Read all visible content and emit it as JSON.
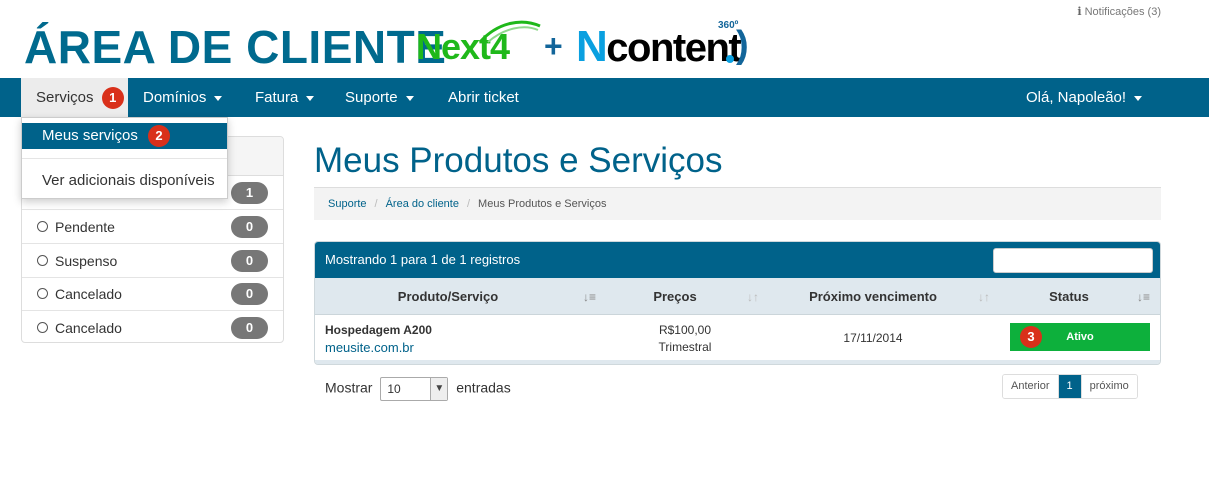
{
  "header": {
    "notifications": "Notificações (3)",
    "brand_title": "ÁREA DE CLIENTE",
    "logo_next4": "Next4",
    "logo_plus": "+",
    "logo_ncontent_n": "N",
    "logo_ncontent_rest": "content",
    "logo_360": "360º",
    "logo_paren": ")"
  },
  "nav": {
    "servicos": "Serviços",
    "servicos_step": "1",
    "dominios": "Domínios",
    "fatura": "Fatura",
    "suporte": "Suporte",
    "abrir_ticket": "Abrir ticket",
    "user": "Olá, Napoleão!"
  },
  "dropdown": {
    "meus_servicos": "Meus serviços",
    "meus_servicos_step": "2",
    "ver_adicionais": "Ver adicionais disponíveis"
  },
  "sidebar": {
    "items": [
      {
        "label": "",
        "count": "1"
      },
      {
        "label": "Pendente",
        "count": "0"
      },
      {
        "label": "Suspenso",
        "count": "0"
      },
      {
        "label": "Cancelado",
        "count": "0"
      },
      {
        "label": "Cancelado",
        "count": "0"
      }
    ]
  },
  "main": {
    "title": "Meus Produtos e Serviços",
    "breadcrumb": [
      "Suporte",
      "Área do cliente",
      "Meus Produtos e Serviços"
    ]
  },
  "table": {
    "showing": "Mostrando 1 para 1 de 1 registros",
    "columns": [
      "Produto/Serviço",
      "Preços",
      "Próximo vencimento",
      "Status"
    ],
    "rows": [
      {
        "product": "Hospedagem A200",
        "domain": "meusite.com.br",
        "price": "R$100,00",
        "cycle": "Trimestral",
        "due": "17/11/2014",
        "status": "Ativo",
        "status_step": "3"
      }
    ]
  },
  "footer": {
    "show_label": "Mostrar",
    "entries_value": "10",
    "entries_label": "entradas",
    "prev": "Anterior",
    "page": "1",
    "next": "próximo"
  },
  "colors": {
    "primary": "#00628a",
    "status_active": "#0db03c",
    "step_badge": "#d9301a"
  }
}
